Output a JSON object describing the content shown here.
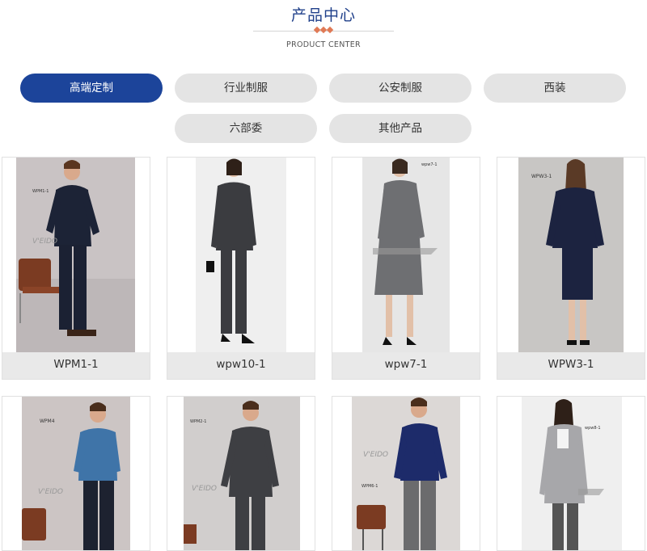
{
  "header": {
    "title": "产品中心",
    "subtitle": "PRODUCT CENTER"
  },
  "tabs": [
    {
      "label": "高端定制",
      "active": true
    },
    {
      "label": "行业制服",
      "active": false
    },
    {
      "label": "公安制服",
      "active": false
    },
    {
      "label": "西装",
      "active": false
    },
    {
      "label": "六部委",
      "active": false
    },
    {
      "label": "其他产品",
      "active": false
    }
  ],
  "products": [
    {
      "name": "WPM1-1",
      "tag": "WPM1-1"
    },
    {
      "name": "wpw10-1",
      "tag": ""
    },
    {
      "name": "wpw7-1",
      "tag": "wpw7-1"
    },
    {
      "name": "WPW3-1",
      "tag": "WPW3-1"
    },
    {
      "name": "WPM4",
      "tag": "WPM4"
    },
    {
      "name": "WPM2-1",
      "tag": "WPM2-1"
    },
    {
      "name": "WPM6-1",
      "tag": "WPM6-1"
    },
    {
      "name": "wpw8-1",
      "tag": "wpw8-1"
    }
  ],
  "colors": {
    "brand": "#1c449a",
    "accent": "#e07a56",
    "tab_bg": "#e4e4e4"
  }
}
